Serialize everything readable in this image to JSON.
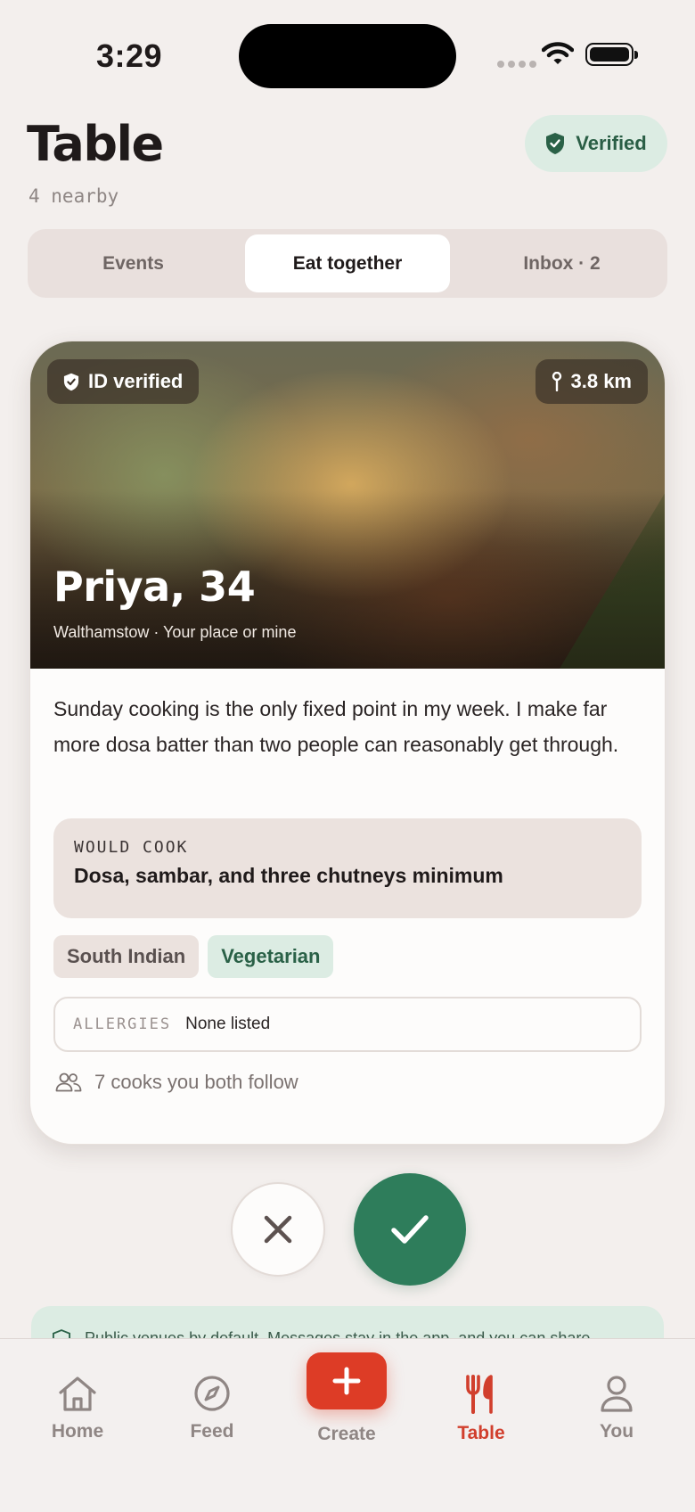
{
  "status_bar": {
    "time": "3:29"
  },
  "header": {
    "title": "Table",
    "subtitle": "4 nearby",
    "verified_label": "Verified"
  },
  "segments": [
    {
      "label": "Events",
      "active": false
    },
    {
      "label": "Eat together",
      "active": true
    },
    {
      "label": "Inbox · 2",
      "active": false
    }
  ],
  "profile": {
    "id_badge": "ID verified",
    "distance": "3.8 km",
    "name": "Priya, 34",
    "location": "Walthamstow · Your place or mine",
    "bio": "Sunday cooking is the only fixed point in my week. I make far more dosa batter than two people can reasonably get through.",
    "would_cook_label": "WOULD COOK",
    "would_cook_value": "Dosa, sambar, and three chutneys minimum",
    "tags": [
      {
        "label": "South Indian",
        "style": "neutral"
      },
      {
        "label": "Vegetarian",
        "style": "green"
      }
    ],
    "allergies_label": "ALLERGIES",
    "allergies_value": "None listed",
    "mutual": "7 cooks you both follow"
  },
  "safety_banner": "Public venues by default. Messages stay in the app, and you can share",
  "tab_bar": [
    {
      "label": "Home",
      "icon": "home-icon",
      "active": false
    },
    {
      "label": "Feed",
      "icon": "compass-icon",
      "active": false
    },
    {
      "label": "Create",
      "icon": "plus-icon",
      "active": false
    },
    {
      "label": "Table",
      "icon": "fork-knife-icon",
      "active": true
    },
    {
      "label": "You",
      "icon": "person-icon",
      "active": false
    }
  ],
  "colors": {
    "accent_red": "#dd3c26",
    "accent_green": "#2e7d5b",
    "background": "#f3efed"
  }
}
